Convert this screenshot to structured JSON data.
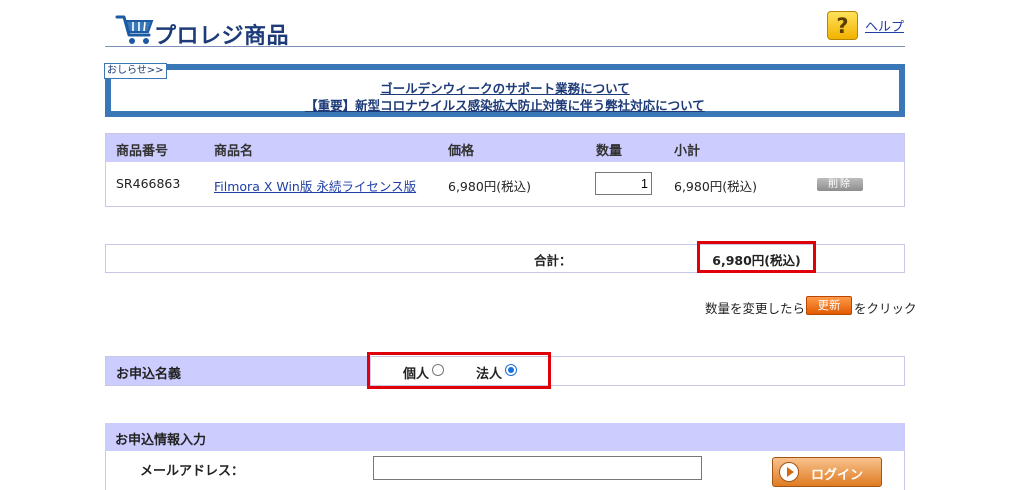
{
  "header": {
    "title": "プロレジ商品",
    "help_label": "ヘルプ",
    "help_icon_glyph": "?"
  },
  "notice": {
    "badge": "おしらせ>>",
    "links": [
      "ゴールデンウィークのサポート業務について",
      "【重要】新型コロナウイルス感染拡大防止対策に伴う弊社対応について"
    ]
  },
  "cart": {
    "columns": [
      "商品番号",
      "商品名",
      "価格",
      "数量",
      "小計"
    ],
    "rows": [
      {
        "product_id": "SR466863",
        "product_name": "Filmora X Win版 永続ライセンス版",
        "price": "6,980円(税込)",
        "quantity": "1",
        "subtotal": "6,980円(税込)",
        "delete_label": "削除"
      }
    ]
  },
  "total": {
    "label": "合計：",
    "value": "6,980円(税込)"
  },
  "update_hint": {
    "before": "数量を変更したら",
    "button": "更新",
    "after": "をクリック"
  },
  "applicant": {
    "label": "お申込名義",
    "options": [
      {
        "label": "個人",
        "checked": false
      },
      {
        "label": "法人",
        "checked": true
      }
    ]
  },
  "info": {
    "title": "お申込情報入力",
    "email_label": "メールアドレス：",
    "email_value": "",
    "login_button": "ログイン"
  },
  "colors": {
    "brand_blue": "#3a77b6",
    "header_band": "#ccccff",
    "highlight_red": "#e0000a",
    "update_orange": "#e25a00"
  }
}
